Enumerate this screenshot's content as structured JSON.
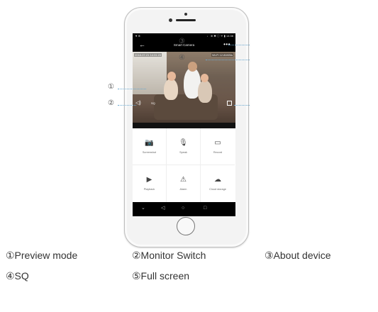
{
  "screen": {
    "status_left": "♥ ⊕",
    "status_right": "♩ ⊚ ✱ ⓘ ᯤ ▮ 14:38",
    "back_glyph": "←",
    "title": "Smart Camera",
    "more_glyph": "•••",
    "timestamp_left": "2018-07-21 14:31:23",
    "timestamp_right": "Wi-Fi 12.81KB/s",
    "sq_label": "SQ",
    "actions": [
      {
        "icon": "camera-icon",
        "glyph": "📷",
        "label": "Screenshot"
      },
      {
        "icon": "microphone-icon",
        "glyph": "🎙",
        "label": "Speak"
      },
      {
        "icon": "video-record-icon",
        "glyph": "▭",
        "label": "Record"
      },
      {
        "icon": "playback-icon",
        "glyph": "▶",
        "label": "Playback"
      },
      {
        "icon": "alarm-icon",
        "glyph": "⚠",
        "label": "Alarm"
      },
      {
        "icon": "cloud-storage-icon",
        "glyph": "☁",
        "label": "Cloud storage"
      }
    ],
    "nav": [
      "⌄",
      "◁",
      "○",
      "□"
    ]
  },
  "callouts": {
    "one": "①",
    "two": "②",
    "three": "③",
    "four": "④",
    "five": "⑤"
  },
  "legend": [
    "①Preview mode",
    "②Monitor Switch",
    "③About device",
    "④SQ",
    "⑤Full screen"
  ]
}
